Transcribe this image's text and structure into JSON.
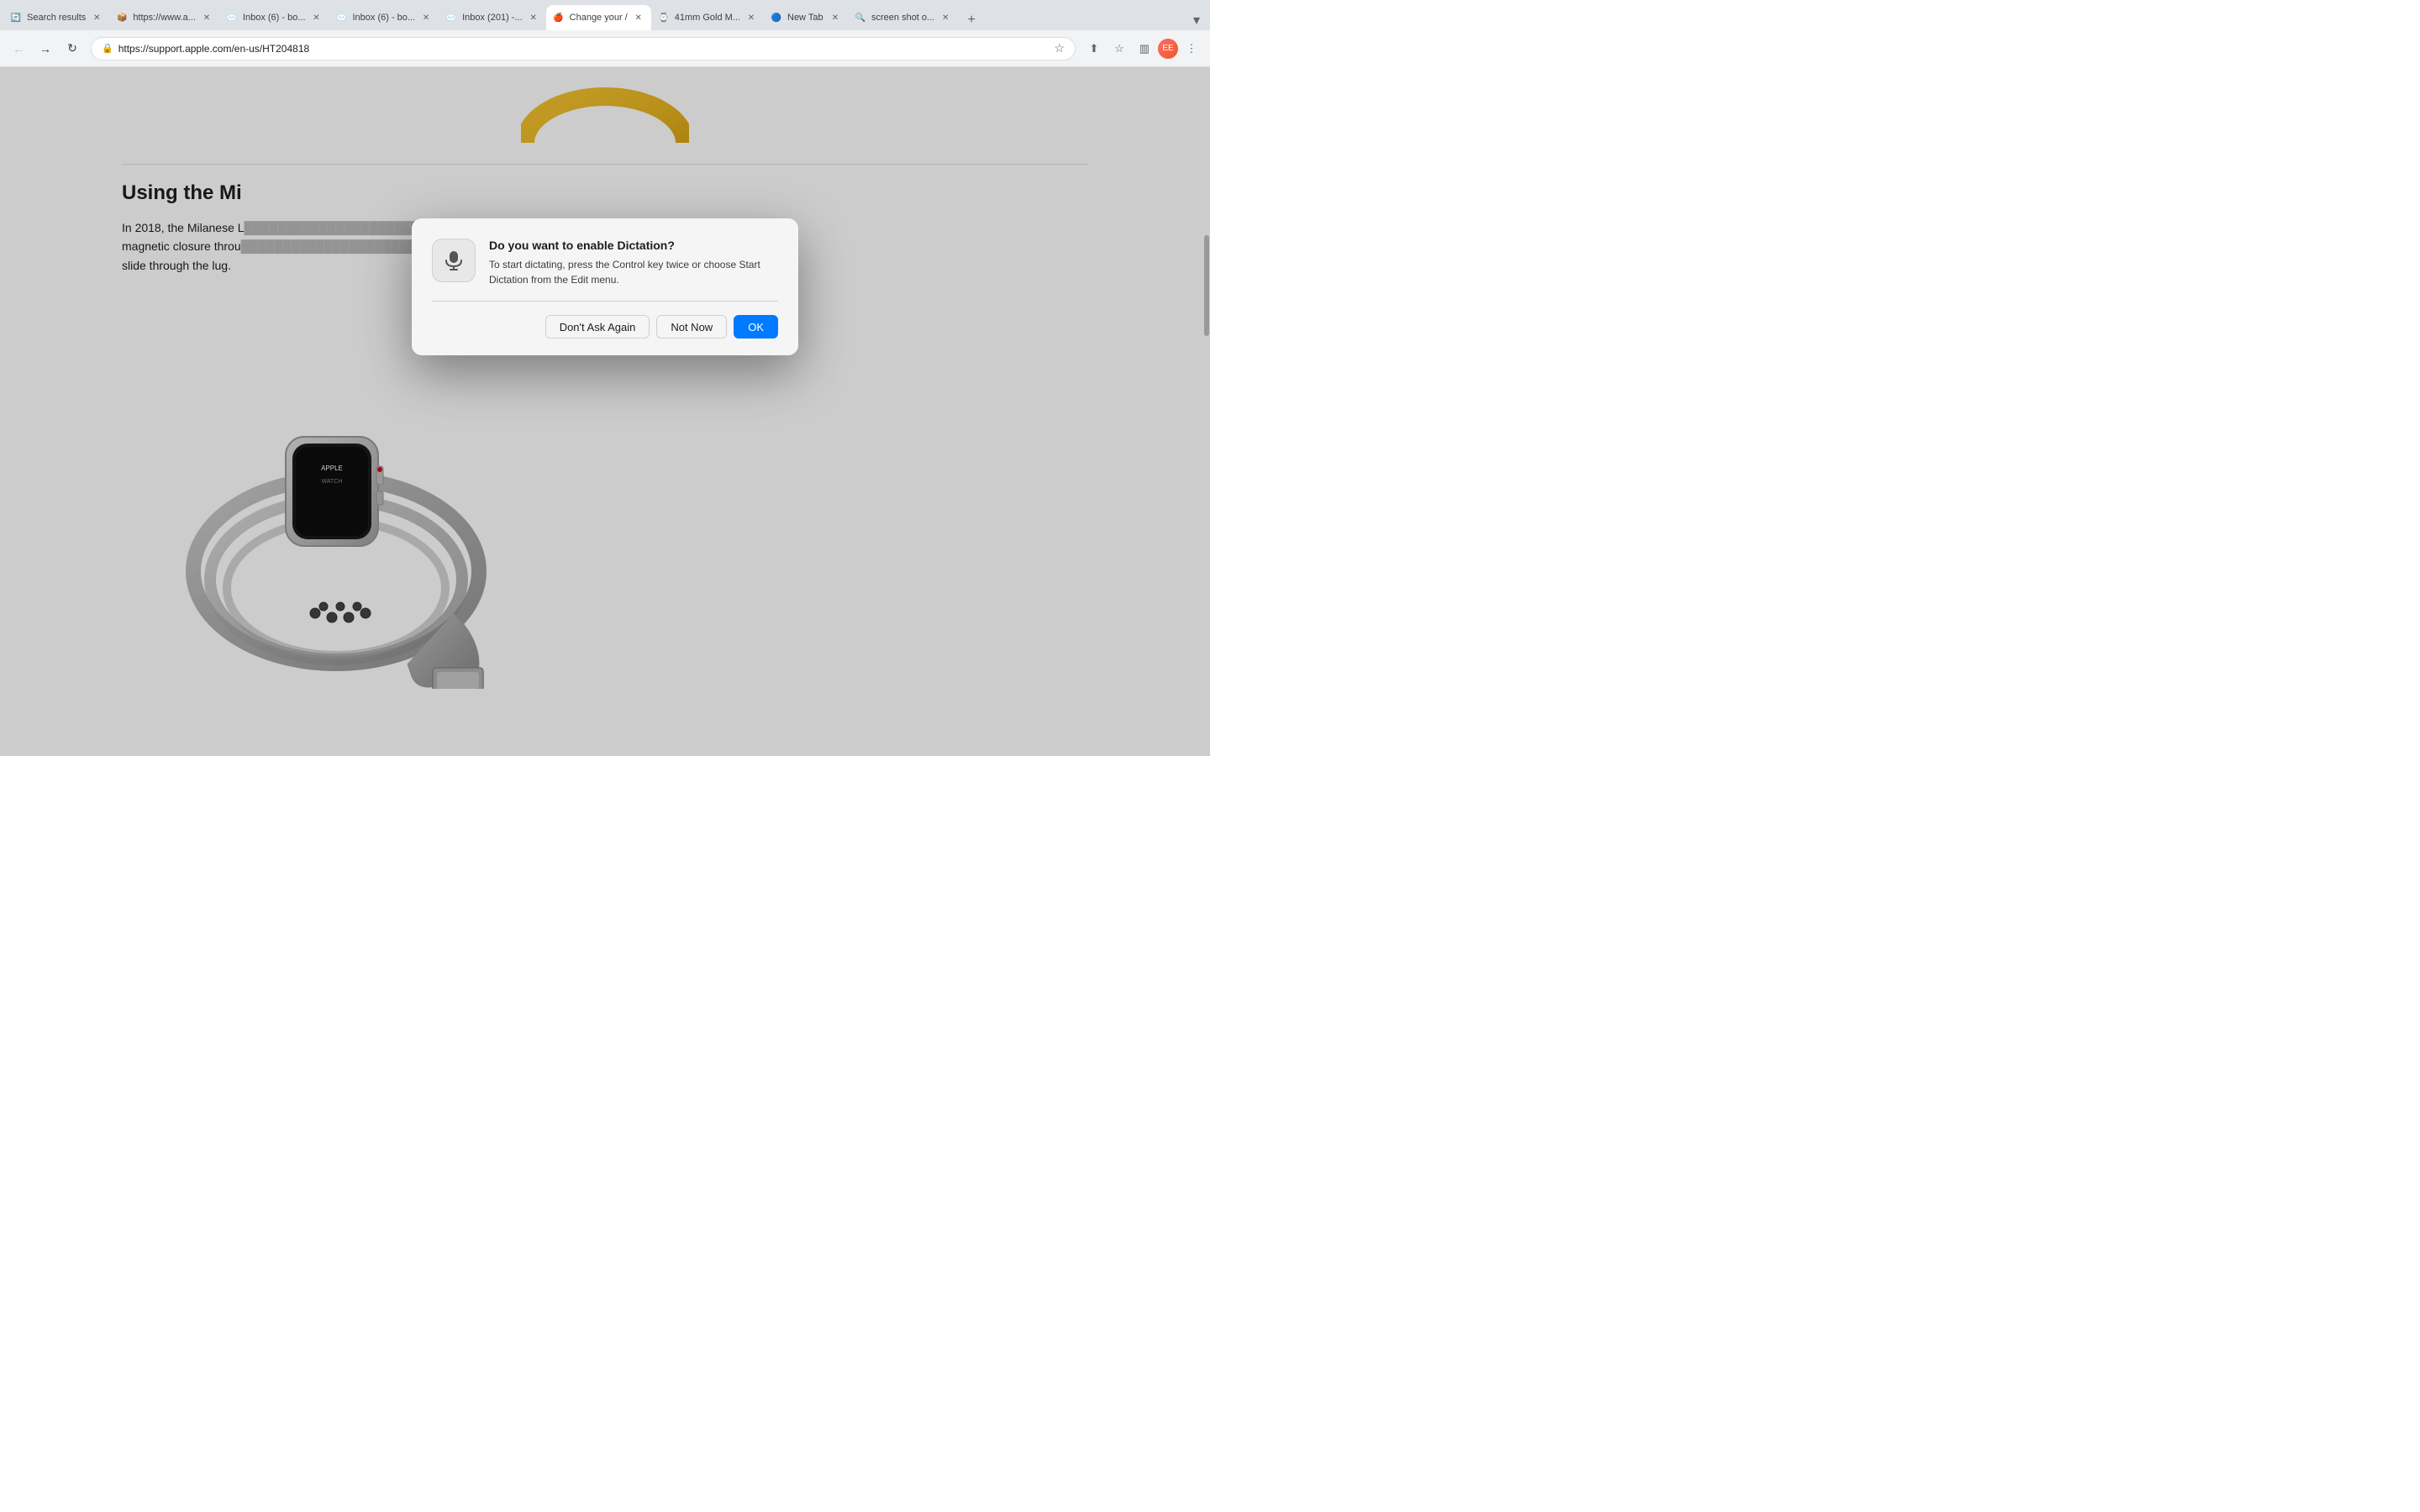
{
  "browser": {
    "url": "https://support.apple.com/en-us/HT204818",
    "tabs": [
      {
        "id": "tab1",
        "favicon": "🔄",
        "title": "Search results",
        "active": false
      },
      {
        "id": "tab2",
        "favicon": "📦",
        "title": "https://www.a...",
        "active": false
      },
      {
        "id": "tab3",
        "favicon": "✉️",
        "title": "Inbox (6) - bo...",
        "active": false
      },
      {
        "id": "tab4",
        "favicon": "✉️",
        "title": "Inbox (6) - bo...",
        "active": false
      },
      {
        "id": "tab5",
        "favicon": "✉️",
        "title": "Inbox (201) -...",
        "active": false
      },
      {
        "id": "tab6",
        "favicon": "🍎",
        "title": "Change your /",
        "active": true
      },
      {
        "id": "tab7",
        "favicon": "⌚",
        "title": "41mm Gold M...",
        "active": false
      },
      {
        "id": "tab8",
        "favicon": "🔵",
        "title": "New Tab",
        "active": false
      },
      {
        "id": "tab9",
        "favicon": "🔍",
        "title": "screen shot o...",
        "active": false
      }
    ]
  },
  "page": {
    "section_title": "Using the Mi",
    "body_text": "In 2018, the Milanese L                                    ly by sliding the magnetic closure throu                                    s, the closure won't slide through the lug."
  },
  "dialog": {
    "title": "Do you want to enable Dictation?",
    "body": "To start dictating, press the Control key twice or choose Start Dictation from the Edit menu.",
    "button_dont_ask": "Don't Ask Again",
    "button_not_now": "Not Now",
    "button_ok": "OK"
  }
}
